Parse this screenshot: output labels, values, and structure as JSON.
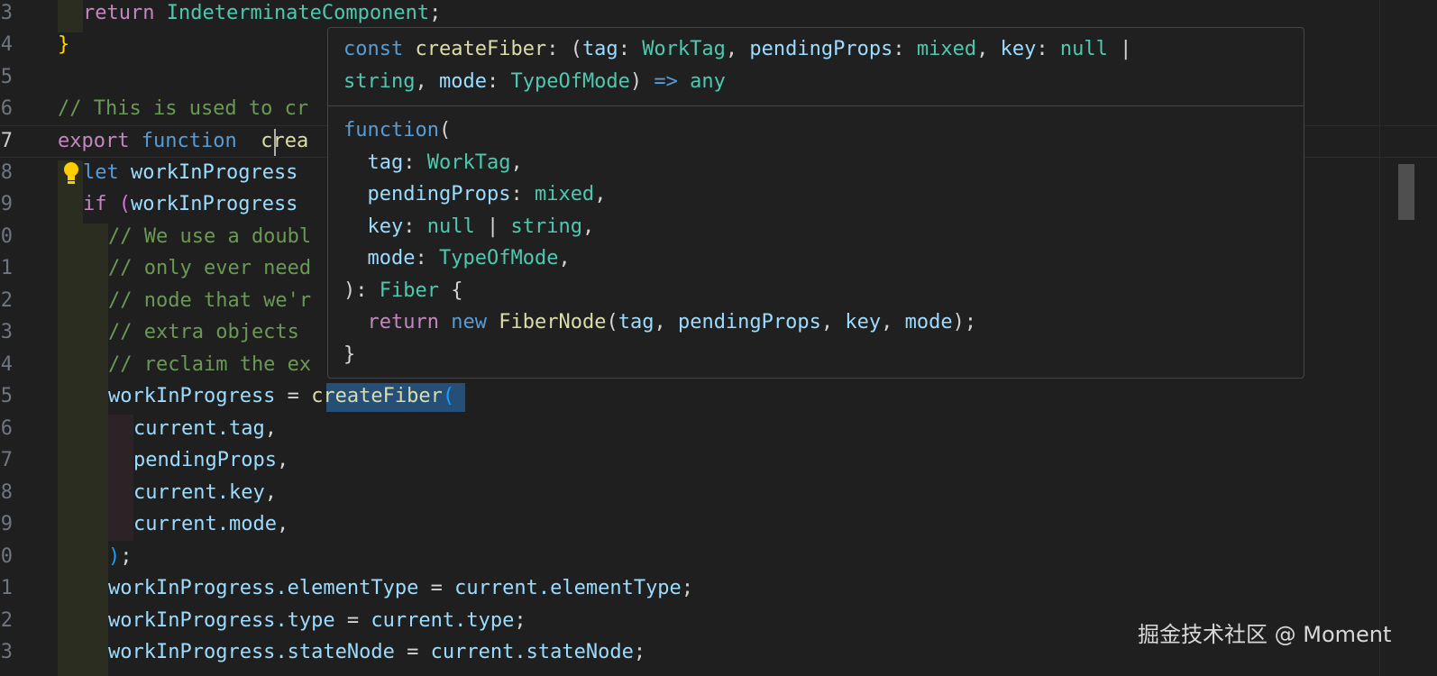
{
  "editor": {
    "line_numbers": [
      "3",
      "4",
      "5",
      "6",
      "7",
      "8",
      "9",
      "0",
      "1",
      "2",
      "3",
      "4",
      "5",
      "6",
      "7",
      "8",
      "9",
      "0",
      "1",
      "2",
      "3"
    ],
    "active_line_number": "7",
    "lines": {
      "l3_kw": "return",
      "l3_type": "IndeterminateComponent",
      "l3_end": ";",
      "l4": "}",
      "l6_comment": "// This is used to cr",
      "l7_export": "export",
      "l7_function": "function",
      "l7_name": "crea",
      "l8_let": "let",
      "l8_var": "workInProgress",
      "l9_if": "if",
      "l9_paren": "(",
      "l9_var": "workInProgress",
      "c10": "// We use a doubl",
      "c11": "// only ever need",
      "c12": "// node that we'r",
      "c13": "// extra objects",
      "c14": "// reclaim the ex",
      "l15_var": "workInProgress",
      "l15_eq": " = ",
      "l15_fn": "createFiber",
      "l15_paren": "(",
      "l16_obj": "current",
      "l16_prop": ".tag",
      "l16_comma": ",",
      "l17_var": "pendingProps",
      "l17_comma": ",",
      "l18_obj": "current",
      "l18_prop": ".key",
      "l18_comma": ",",
      "l19_obj": "current",
      "l19_prop": ".mode",
      "l19_comma": ",",
      "l20_paren": ")",
      "l20_semi": ";",
      "l21_a": "workInProgress",
      "l21_b": ".elementType",
      "l21_eq": " = ",
      "l21_c": "current",
      "l21_d": ".elementType",
      "l21_semi": ";",
      "l22_a": "workInProgress",
      "l22_b": ".type",
      "l22_eq": " = ",
      "l22_c": "current",
      "l22_d": ".type",
      "l22_semi": ";",
      "l23_a": "workInProgress",
      "l23_b": ".stateNode",
      "l23_eq": " = ",
      "l23_c": "current",
      "l23_d": ".stateNode",
      "l23_semi": ";"
    }
  },
  "hover": {
    "sig": {
      "const": "const",
      "name": "createFiber",
      "p1": ": (",
      "tag": "tag",
      "c1": ": ",
      "WorkTag": "WorkTag",
      "comma1": ", ",
      "pendingProps": "pendingProps",
      "c2": ": ",
      "mixed": "mixed",
      "comma2": ", ",
      "key": "key",
      "c3": ": ",
      "null": "null",
      "pipe": " |",
      "string": "string",
      "comma3": ", ",
      "mode": "mode",
      "c4": ": ",
      "TypeOfMode": "TypeOfMode",
      "close": ")",
      "arrow": " => ",
      "any": "any"
    },
    "body": {
      "function": "function",
      "open": "(",
      "tag": "tag",
      "tag_colon": ": ",
      "WorkTag": "WorkTag",
      "tag_comma": ",",
      "pendingProps": "pendingProps",
      "pp_colon": ": ",
      "mixed": "mixed",
      "pp_comma": ",",
      "key": "key",
      "key_colon": ": ",
      "null": "null",
      "pipe": " | ",
      "string": "string",
      "key_comma": ",",
      "mode": "mode",
      "mode_colon": ": ",
      "TypeOfMode": "TypeOfMode",
      "mode_comma": ",",
      "close": "): ",
      "Fiber": "Fiber",
      "brace_open": " {",
      "return": "return",
      "new": "new",
      "FiberNode": "FiberNode",
      "args_open": "(",
      "a_tag": "tag",
      "a_c1": ", ",
      "a_pp": "pendingProps",
      "a_c2": ", ",
      "a_key": "key",
      "a_c3": ", ",
      "a_mode": "mode",
      "args_close": ");",
      "brace_close": "}"
    }
  },
  "watermark": "掘金技术社区 @ Moment",
  "colors": {
    "background": "#1f1f1f",
    "keyword": "#c586c0",
    "storage": "#569cd6",
    "function": "#dcdcaa",
    "variable": "#9cdcfe",
    "type": "#4ec9b0",
    "comment": "#6a9955"
  },
  "icons": [
    "lightbulb-icon"
  ]
}
